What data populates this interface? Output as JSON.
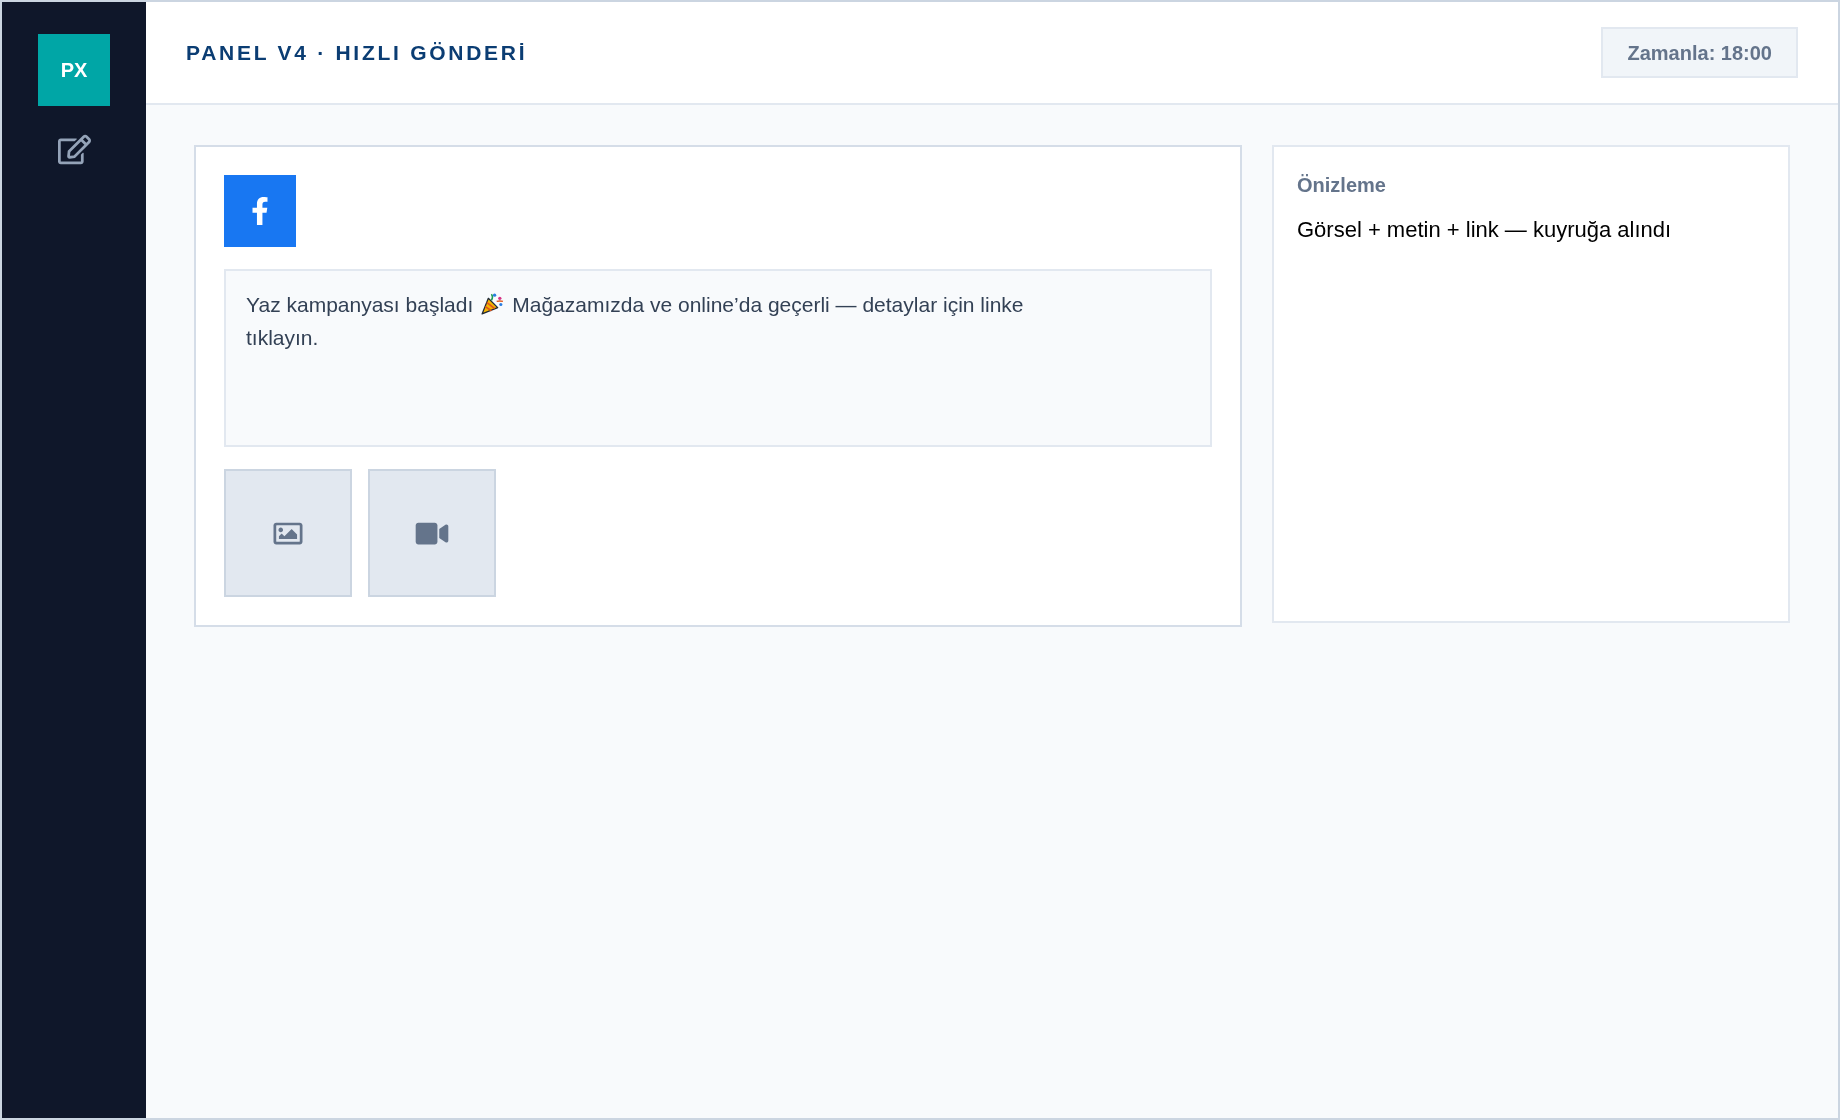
{
  "sidebar": {
    "logo": "PX"
  },
  "header": {
    "title": "PANEL V4 · HIZLI GÖNDERİ",
    "schedule_button": "Zamanla: 18:00"
  },
  "composer": {
    "networks": [
      {
        "kind": "facebook"
      }
    ],
    "post_text": [
      "Yaz kampanyası başladı",
      "Mağazamızda ve online’da geçerli — detaylar için linke tıklayın."
    ],
    "attachments": [
      {
        "kind": "image"
      },
      {
        "kind": "video"
      }
    ]
  },
  "preview": {
    "title": "Önizleme",
    "text": "Görsel + metin + link — kuyruğa alındı"
  }
}
